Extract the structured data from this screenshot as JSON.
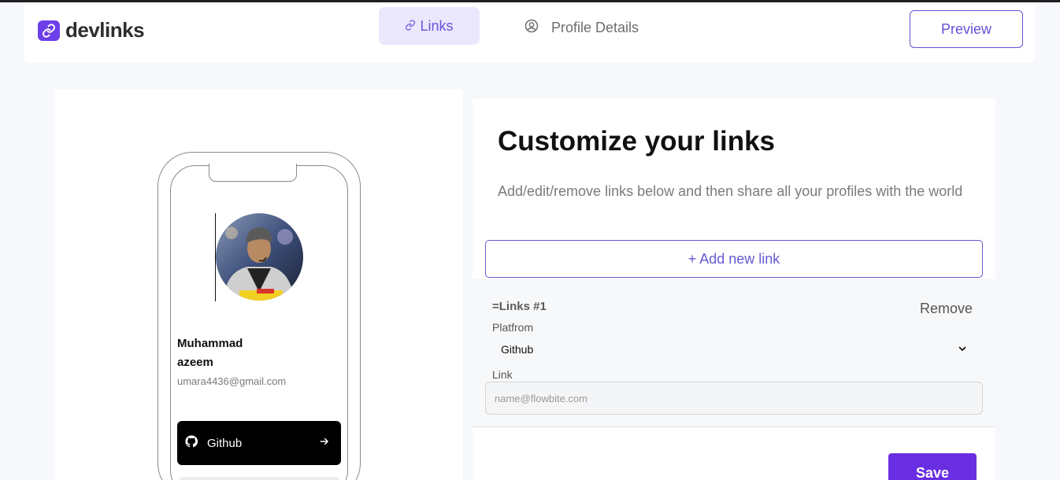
{
  "app": {
    "name": "devlinks"
  },
  "nav": {
    "links_tab": "Links",
    "profile_tab": "Profile Details",
    "preview_button": "Preview"
  },
  "preview": {
    "name_line1": "Muhammad",
    "name_line2": "azeem",
    "email": "umara4436@gmail.com",
    "links": [
      {
        "label": "Github",
        "icon": "github-icon"
      }
    ]
  },
  "editor": {
    "title": "Customize your links",
    "subtitle": "Add/edit/remove links below and then share all your profiles with the world",
    "add_link_button": "+ Add new link",
    "link_card": {
      "title": "=Links #1",
      "remove": "Remove",
      "platform_label": "Platfrom",
      "platform_value": "Github",
      "link_label": "Link",
      "link_placeholder": "name@flowbite.com",
      "link_value": ""
    },
    "save_button": "Save"
  },
  "colors": {
    "accent": "#6a2ee2",
    "accent_light": "#ebe7fd",
    "background": "#f6f8fb"
  }
}
